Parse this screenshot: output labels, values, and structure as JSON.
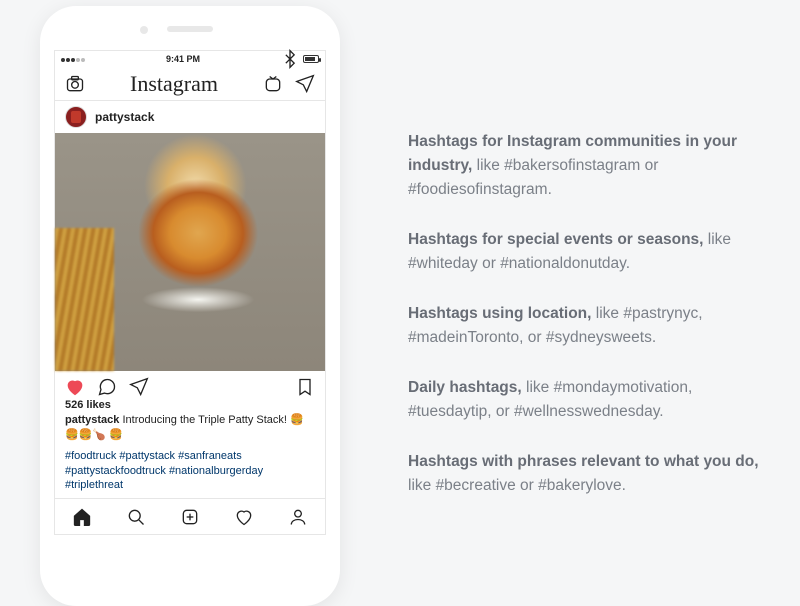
{
  "phone": {
    "time": "9:41 PM",
    "app_logo": "Instagram",
    "post": {
      "username": "pattystack",
      "likes_label": "526 likes",
      "caption_user": "pattystack",
      "caption_text": " Introducing the Triple Patty Stack! 🍔🍔🍔🍗 🍔",
      "hashtags_line1": "#foodtruck #pattystack #sanfraneats",
      "hashtags_line2": "#pattystackfoodtruck #nationalburgerday",
      "hashtags_line3": "#triplethreat"
    }
  },
  "tips": [
    {
      "bold": "Hashtags for Instagram communities in your industry,",
      "rest": " like #bakersofinstagram or #foodiesofinstagram."
    },
    {
      "bold": "Hashtags for special events or seasons,",
      "rest": " like #whiteday or #nationaldonutday."
    },
    {
      "bold": "Hashtags using location,",
      "rest": " like #pastrynyc, #madeinToronto, or #sydneysweets."
    },
    {
      "bold": "Daily hashtags,",
      "rest": " like #mondaymotivation, #tuesdaytip, or #wellnesswednesday."
    },
    {
      "bold": "Hashtags with phrases relevant to what you do,",
      "rest": " like #becreative or #bakerylove."
    }
  ]
}
